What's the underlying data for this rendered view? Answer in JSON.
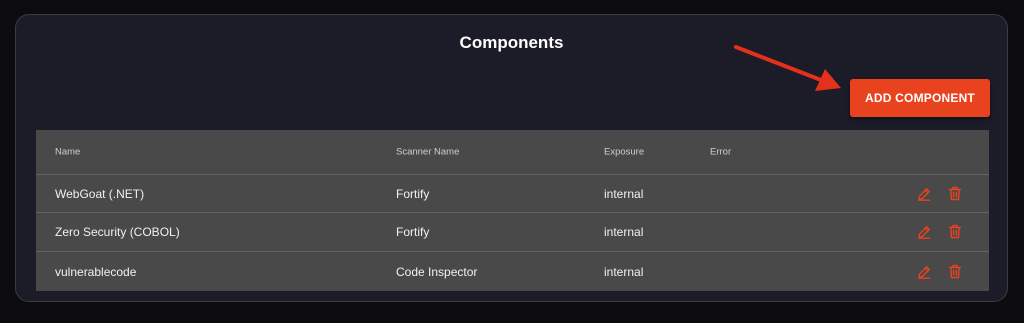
{
  "page": {
    "title": "Components"
  },
  "actions": {
    "add_label": "ADD COMPONENT"
  },
  "table": {
    "columns": [
      "Name",
      "Scanner Name",
      "Exposure",
      "Error"
    ],
    "rows": [
      {
        "name": "WebGoat (.NET)",
        "scanner": "Fortify",
        "exposure": "internal",
        "error": ""
      },
      {
        "name": "Zero Security (COBOL)",
        "scanner": "Fortify",
        "exposure": "internal",
        "error": ""
      },
      {
        "name": "vulnerablecode",
        "scanner": "Code Inspector",
        "exposure": "internal",
        "error": ""
      }
    ]
  },
  "icons": {
    "row_actions": [
      "pencil-icon",
      "trash-icon"
    ],
    "annotation": "red-arrow-icon"
  },
  "colors": {
    "accent": "#e8421e",
    "panel": "#1b1c27",
    "table": "#494949",
    "background": "#0c0c0e"
  }
}
